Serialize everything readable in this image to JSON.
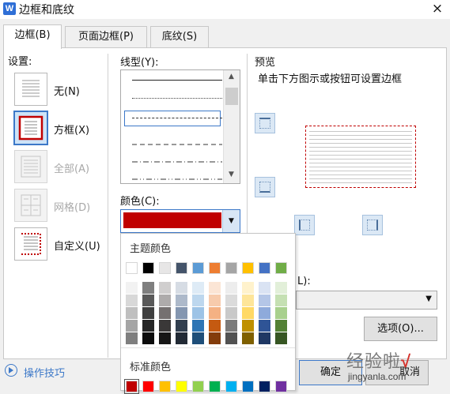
{
  "window": {
    "title": "边框和底纹",
    "close_symbol": "×",
    "app_icon_letter": "W"
  },
  "tabs": [
    {
      "label": "边框(B)",
      "active": true
    },
    {
      "label": "页面边框(P)",
      "active": false
    },
    {
      "label": "底纹(S)",
      "active": false
    }
  ],
  "settings": {
    "heading": "设置:",
    "items": [
      {
        "label": "无(N)",
        "state": "normal"
      },
      {
        "label": "方框(X)",
        "state": "selected"
      },
      {
        "label": "全部(A)",
        "state": "disabled"
      },
      {
        "label": "网格(D)",
        "state": "disabled"
      },
      {
        "label": "自定义(U)",
        "state": "normal"
      }
    ]
  },
  "line_style": {
    "label": "线型(Y):",
    "styles": [
      "solid",
      "dotted-fine",
      "dashed-small",
      "dashed",
      "dash-dot",
      "dash-dot-dot",
      "long-dash"
    ],
    "selected_index": 2
  },
  "color": {
    "label": "颜色(C):",
    "selected": "#c00000"
  },
  "palette": {
    "theme_label": "主题颜色",
    "standard_label": "标准颜色",
    "theme_top": [
      "#ffffff",
      "#000000",
      "#e7e6e6",
      "#44546a",
      "#5b9bd5",
      "#ed7d31",
      "#a5a5a5",
      "#ffc000",
      "#4472c4",
      "#70ad47"
    ],
    "theme_shades": [
      [
        "#f2f2f2",
        "#7f7f7f",
        "#d0cece",
        "#d6dce4",
        "#deebf6",
        "#fbe5d5",
        "#ededed",
        "#fff2cc",
        "#dae3f3",
        "#e2efd9"
      ],
      [
        "#d8d8d8",
        "#595959",
        "#aeabab",
        "#adb9ca",
        "#bdd7ee",
        "#f7cbac",
        "#dbdbdb",
        "#fee599",
        "#b4c6e7",
        "#c5e0b3"
      ],
      [
        "#bfbfbf",
        "#3f3f3f",
        "#757070",
        "#8496b0",
        "#9dc3e6",
        "#f4b183",
        "#c9c9c9",
        "#ffd966",
        "#8eaadb",
        "#a8d08d"
      ],
      [
        "#a5a5a5",
        "#262626",
        "#3a3838",
        "#323f4f",
        "#2e75b5",
        "#c55a11",
        "#7b7b7b",
        "#bf9000",
        "#2f5496",
        "#538135"
      ],
      [
        "#7f7f7f",
        "#0c0c0c",
        "#171616",
        "#222a35",
        "#1e4e79",
        "#833c0b",
        "#525252",
        "#7f6000",
        "#1f3864",
        "#375623"
      ]
    ],
    "standard": [
      "#c00000",
      "#ff0000",
      "#ffc000",
      "#ffff00",
      "#92d050",
      "#00b050",
      "#00b0f0",
      "#0070c0",
      "#002060",
      "#7030a0"
    ]
  },
  "preview": {
    "heading": "预览",
    "hint": "单击下方图示或按钮可设置边框",
    "border_color": "#c00000"
  },
  "apply_to": {
    "label_fragment": "L):",
    "value": ""
  },
  "buttons": {
    "options": "选项(O)...",
    "ok": "确定",
    "cancel_fragment": "取消"
  },
  "footer": {
    "tips_link": "操作技巧"
  },
  "watermark": {
    "text": "经验啦",
    "check": "√",
    "url": "jingyanla.com"
  }
}
